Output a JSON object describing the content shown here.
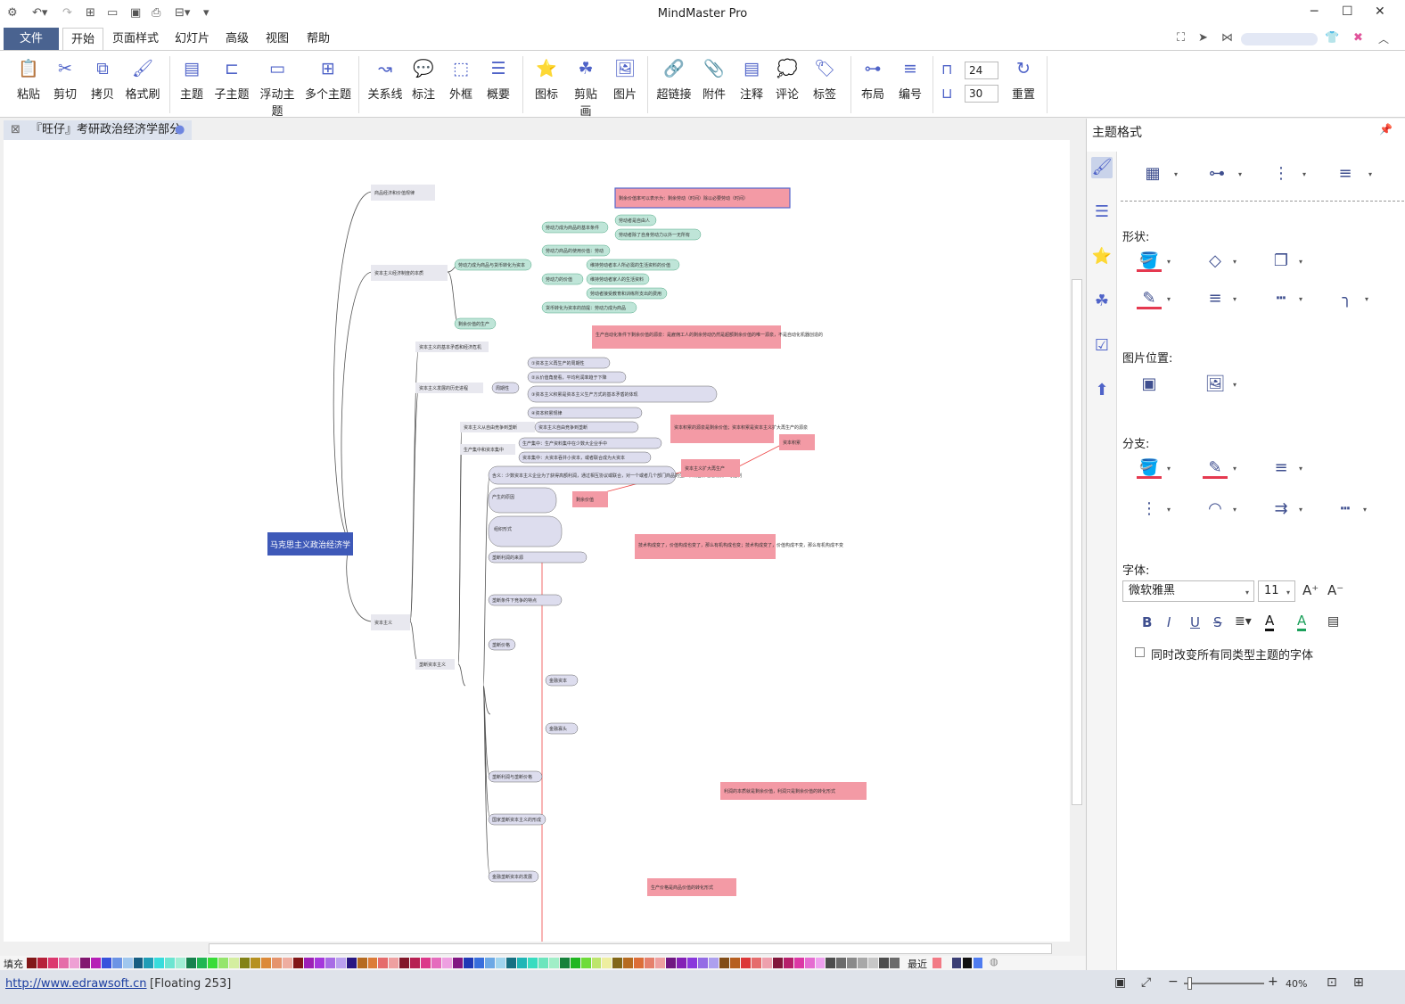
{
  "app": {
    "title": "MindMaster Pro"
  },
  "menu": {
    "file": "文件",
    "tabs": [
      "开始",
      "页面样式",
      "幻灯片",
      "高级",
      "视图",
      "帮助"
    ]
  },
  "ribbon": {
    "clipboard": [
      "粘贴",
      "剪切",
      "拷贝",
      "格式刷"
    ],
    "topics": [
      "主题",
      "子主题",
      "浮动主题",
      "多个主题"
    ],
    "relations": [
      "关系线",
      "标注",
      "外框",
      "概要"
    ],
    "insert": [
      "图标",
      "剪贴画",
      "图片"
    ],
    "links": [
      "超链接",
      "附件",
      "注释",
      "评论",
      "标签"
    ],
    "layout": [
      "布局",
      "编号"
    ],
    "spacing_h": "24",
    "spacing_v": "30",
    "reset": "重置"
  },
  "doc_tab": {
    "title": "『旺仔』考研政治经济学部分"
  },
  "panel": {
    "title": "主题格式",
    "shape_label": "形状:",
    "image_pos_label": "图片位置:",
    "branch_label": "分支:",
    "font_label": "字体:",
    "font_name": "微软雅黑",
    "font_size": "11",
    "apply_all": "同时改变所有同类型主题的字体"
  },
  "palette": {
    "fill_label": "填充",
    "recent_label": "最近"
  },
  "status": {
    "url": "http://www.edrawsoft.cn",
    "floating": "[Floating 253]",
    "zoom": "40%"
  },
  "map": {
    "root": "马克思主义政治经济学",
    "branches": [
      {
        "label": "商品经济和价值规律"
      },
      {
        "label": "资本主义经济制度的本质",
        "children": [
          "劳动力成为商品与货币转化为资本",
          "剩余价值的生产"
        ]
      },
      {
        "label": "资本主义",
        "children": [
          "资本主义的基本矛盾和经济危机",
          "资本主义发展的历史进程",
          "资本主义从自由竞争到垄断",
          "生产集中和资本集中",
          "垄断资本主义"
        ]
      }
    ],
    "leaves": [
      "劳动力成为商品的基本条件",
      "劳动者是自由人",
      "劳动者除了自身劳动力以外一无所有",
      "劳动力商品的使用价值：劳动",
      "劳动力的价值",
      "维持劳动者本人所必需的生活资料的价值",
      "维持劳动者家人的生活资料",
      "劳动者接受教育和训练所支出的费用",
      "货币转化为资本的前提：劳动力成为商品",
      "①资本主义再生产的周期性",
      "②从价值角度看，平均利润率趋于下降",
      "③资本主义积累是资本主义生产方式的基本矛盾的体现",
      "④资本积累规律",
      "周期性",
      "资本主义自由竞争到垄断",
      "生产集中：生产资料集中在少数大企业手中",
      "资本集中：大资本吞并小资本，或者联合成为大资本",
      "含义：少数资本主义企业为了获得高额利润，通过相互协议或联合，对一个或者几个部门商品的生产和销售价格进行操纵与控制",
      "产生的原因",
      "组织形式",
      "垄断利润的来源",
      "垄断条件下竞争的特点",
      "垄断价格",
      "金融资本",
      "金融寡头",
      "垄断利润与垄断价格",
      "国家垄断资本主义的形成",
      "金融垄断资本的发展"
    ],
    "notes": [
      "剩余价值率可以表示为：剩余劳动（时间）除以必要劳动（时间）",
      "生产自动化条件下剩余价值的源泉：是雇佣工人的剩余劳动仍然是超额剩余价值的唯一源泉，不是自动化机器创造的",
      "资本积累的源泉是剩余价值；资本积累是资本主义扩大再生产的源泉",
      "资本积累",
      "资本主义扩大再生产",
      "剩余价值",
      "技术构成变了，价值构成也变了，那么有机构成也变；技术构成变了，价值构成不变，那么有机构成不变",
      "利润的本质就是剩余价值，利润只是剩余价值的转化形式",
      "生产价格是商品价值的转化形式"
    ]
  }
}
